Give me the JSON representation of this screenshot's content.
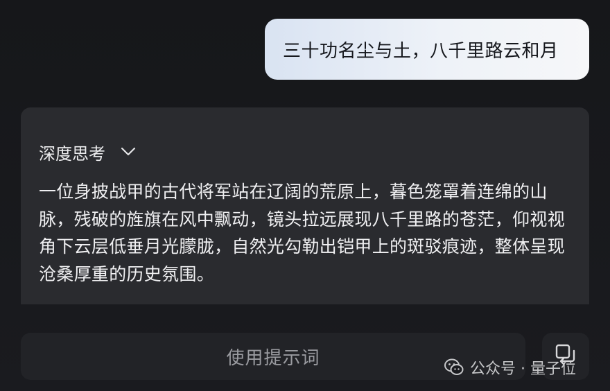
{
  "user_message": {
    "text": "三十功名尘与土，八千里路云和月"
  },
  "assistant": {
    "thinking_label": "深度思考",
    "answer": "一位身披战甲的古代将军站在辽阔的荒原上，暮色笼罩着连绵的山脉，残破的旌旗在风中飘动，镜头拉远展现八千里路的苍茫，仰视视角下云层低垂月光朦胧，自然光勾勒出铠甲上的斑驳痕迹，整体呈现沧桑厚重的历史氛围。"
  },
  "actions": {
    "use_prompt_label": "使用提示词",
    "copy_icon": "copy-icon"
  },
  "watermark": {
    "text": "公众号 · 量子位",
    "icon": "wechat-icon"
  },
  "colors": {
    "background": "#17181b",
    "card": "#2a2b2f",
    "user_bubble": "#eef2f8"
  }
}
